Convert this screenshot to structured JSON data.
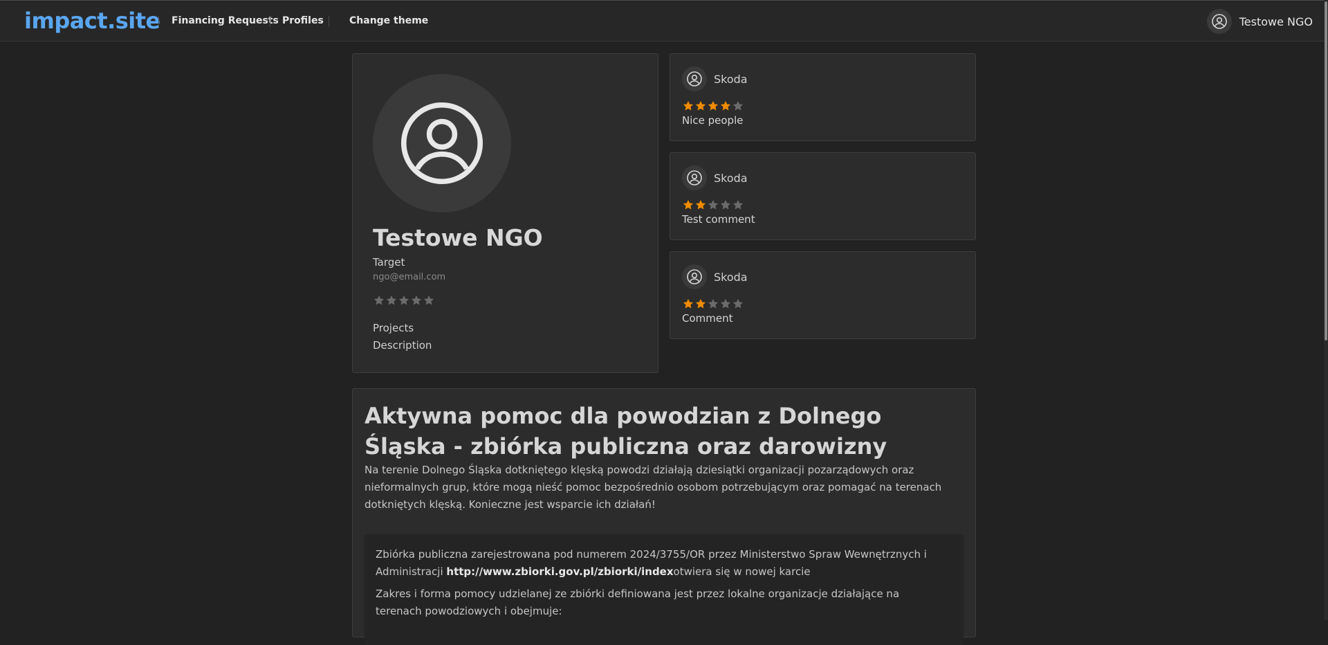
{
  "header": {
    "logo": "impact.site",
    "nav": [
      {
        "label": "Financing Requests"
      },
      {
        "label": "Profiles"
      },
      {
        "label": "Change theme"
      }
    ],
    "user_name": "Testowe NGO",
    "user_icon": "user-circle-icon"
  },
  "profile": {
    "avatar_icon": "user-circle-icon",
    "name": "Testowe NGO",
    "role": "Target",
    "email": "ngo@email.com",
    "rating": 0,
    "rating_max": 5,
    "links": [
      "Projects",
      "Description"
    ]
  },
  "reviews": [
    {
      "author": "Skoda",
      "rating": 4,
      "comment": "Nice people"
    },
    {
      "author": "Skoda",
      "rating": 2,
      "comment": "Test comment"
    },
    {
      "author": "Skoda",
      "rating": 2,
      "comment": "Comment"
    }
  ],
  "project": {
    "title": "Aktywna pomoc dla powodzian z Dolnego Śląska - zbiórka publiczna oraz darowizny",
    "description": "Na terenie Dolnego Śląska dotkniętego klęską powodzi działają dziesiątki organizacji pozarządowych oraz nieformalnych grup, które mogą nieść pomoc bezpośrednio osobom potrzebującym oraz pomagać na terenach dotkniętych klęską. Konieczne jest wsparcie ich działań!",
    "registration_text": "Zbiórka publiczna zarejestrowana pod numerem 2024/3755/OR przez Ministerstwo Spraw Wewnętrznych i Administracji",
    "registration_link": "http://www.zbiorki.gov.pl/zbiorki/index",
    "registration_link_note": "otwiera się w nowej karcie",
    "scope_text": "Zakres i forma pomocy udzielanej ze zbiórki definiowana jest przez lokalne organizacje działające na terenach powodziowych i obejmuje:"
  },
  "colors": {
    "background": "#222222",
    "topbar": "#272727",
    "card": "#2c2c2c",
    "accent_logo": "#5aa6f0",
    "star_filled": "#f08c00",
    "star_empty": "#6b6b6b"
  }
}
